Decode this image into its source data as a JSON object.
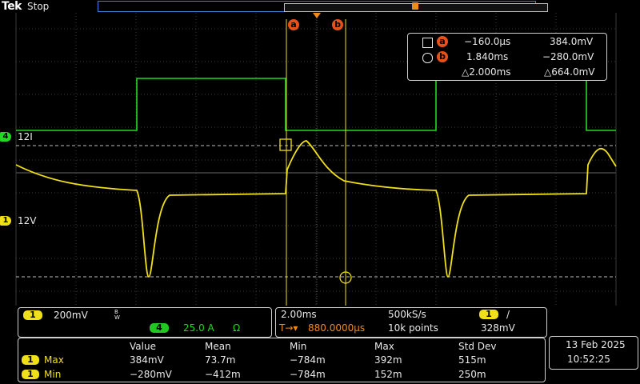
{
  "header": {
    "brand": "Tek",
    "status": "Stop"
  },
  "cursors": {
    "a_label": "a",
    "b_label": "b",
    "a_time": "−160.0µs",
    "a_value": "384.0mV",
    "b_time": "1.840ms",
    "b_value": "−280.0mV",
    "delta_time": "△2.000ms",
    "delta_value": "△664.0mV"
  },
  "channels": {
    "ch4_marker": "4",
    "ch4_level": "12I",
    "ch4_color": "#22d822",
    "ch1_marker": "1",
    "ch1_level": "12V",
    "ch1_color": "#f0e018"
  },
  "vertical": {
    "ch1_badge": "1",
    "ch1_scale": "200mV",
    "bw_icon": "B W",
    "ch4_badge": "4",
    "ch4_scale": "25.0 A",
    "ch4_unit": "Ω"
  },
  "horizontal": {
    "timebase": "2.00ms",
    "sample_rate": "500kS/s",
    "trigger_position": "880.0000µs",
    "record_length": "10k points",
    "trigger_channel": "1",
    "trigger_slope": "/",
    "trigger_level": "328mV"
  },
  "measurements": {
    "headers": [
      "Value",
      "Mean",
      "Min",
      "Max",
      "Std Dev"
    ],
    "rows": [
      {
        "ch": "1",
        "name": "Max",
        "values": [
          "384mV",
          "73.7m",
          "−784m",
          "392m",
          "515m"
        ]
      },
      {
        "ch": "1",
        "name": "Min",
        "values": [
          "−280mV",
          "−412m",
          "−784m",
          "152m",
          "250m"
        ]
      }
    ]
  },
  "datetime": {
    "date": "13 Feb  2025",
    "time": "10:52:25"
  }
}
